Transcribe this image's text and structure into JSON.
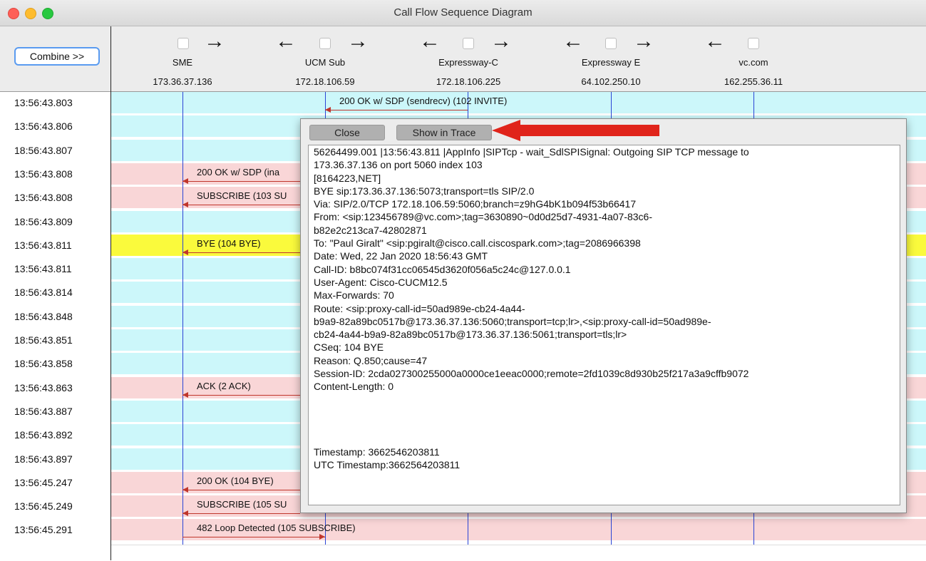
{
  "window": {
    "title": "Call Flow Sequence Diagram"
  },
  "toolbar": {
    "combine_label": "Combine >>"
  },
  "endpoints": [
    {
      "name": "SME",
      "ip": "173.36.37.136"
    },
    {
      "name": "UCM Sub",
      "ip": "172.18.106.59"
    },
    {
      "name": "Expressway-C",
      "ip": "172.18.106.225"
    },
    {
      "name": "Expressway E",
      "ip": "64.102.250.10"
    },
    {
      "name": "vc.com",
      "ip": "162.255.36.11"
    }
  ],
  "arrows": {
    "right": "→",
    "left": "←"
  },
  "rows": [
    {
      "time": "13:56:43.803",
      "color": "cyan",
      "label": "200 OK w/ SDP (sendrecv)  (102 INVITE)"
    },
    {
      "time": "13:56:43.806",
      "color": "cyan",
      "label": ""
    },
    {
      "time": "18:56:43.807",
      "color": "cyan",
      "label": ""
    },
    {
      "time": "13:56:43.808",
      "color": "pink",
      "label": "200 OK w/ SDP (ina"
    },
    {
      "time": "13:56:43.808",
      "color": "pink",
      "label": "SUBSCRIBE (103 SU"
    },
    {
      "time": "18:56:43.809",
      "color": "cyan",
      "label": ""
    },
    {
      "time": "13:56:43.811",
      "color": "yellow",
      "label": "BYE (104 BYE)"
    },
    {
      "time": "13:56:43.811",
      "color": "cyan",
      "label": ""
    },
    {
      "time": "18:56:43.814",
      "color": "cyan",
      "label": ""
    },
    {
      "time": "18:56:43.848",
      "color": "cyan",
      "label": ""
    },
    {
      "time": "18:56:43.851",
      "color": "cyan",
      "label": ""
    },
    {
      "time": "18:56:43.858",
      "color": "cyan",
      "label": ""
    },
    {
      "time": "13:56:43.863",
      "color": "pink",
      "label": "ACK (2 ACK)"
    },
    {
      "time": "18:56:43.887",
      "color": "cyan",
      "label": ""
    },
    {
      "time": "18:56:43.892",
      "color": "cyan",
      "label": ""
    },
    {
      "time": "18:56:43.897",
      "color": "cyan",
      "label": ""
    },
    {
      "time": "13:56:45.247",
      "color": "pink",
      "label": "200 OK (104 BYE)"
    },
    {
      "time": "13:56:45.249",
      "color": "pink",
      "label": "SUBSCRIBE (105 SU"
    },
    {
      "time": "13:56:45.291",
      "color": "pink",
      "label": "482 Loop Detected (105 SUBSCRIBE)"
    }
  ],
  "popup": {
    "close_label": "Close",
    "show_trace_label": "Show in Trace",
    "lines": [
      "56264499.001 |13:56:43.811 |AppInfo  |SIPTcp - wait_SdlSPISignal: Outgoing SIP TCP message to",
      "173.36.37.136 on port 5060 index 103",
      "[8164223,NET]",
      "BYE sip:173.36.37.136:5073;transport=tls SIP/2.0",
      "Via: SIP/2.0/TCP 172.18.106.59:5060;branch=z9hG4bK1b094f53b66417",
      "From: <sip:123456789@vc.com>;tag=3630890~0d0d25d7-4931-4a07-83c6-",
      "b82e2c213ca7-42802871",
      "To: \"Paul Giralt\" <sip:pgiralt@cisco.call.ciscospark.com>;tag=2086966398",
      "Date: Wed, 22 Jan 2020 18:56:43 GMT",
      "Call-ID: b8bc074f31cc06545d3620f056a5c24c@127.0.0.1",
      "User-Agent: Cisco-CUCM12.5",
      "Max-Forwards: 70",
      "Route: <sip:proxy-call-id=50ad989e-cb24-4a44-",
      "b9a9-82a89bc0517b@173.36.37.136:5060;transport=tcp;lr>,<sip:proxy-call-id=50ad989e-",
      "cb24-4a44-b9a9-82a89bc0517b@173.36.37.136:5061;transport=tls;lr>",
      "CSeq: 104 BYE",
      "Reason: Q.850;cause=47",
      "Session-ID: 2cda027300255000a0000ce1eeac0000;remote=2fd1039c8d930b25f217a3a9cffb9072",
      "Content-Length: 0",
      "",
      "",
      "",
      "",
      "Timestamp: 3662546203811",
      "UTC Timestamp:3662564203811"
    ]
  },
  "colors": {
    "cyan": "#ccf7fa",
    "pink": "#f9d6d7",
    "yellow": "#fafa3c",
    "lifeline": "#2b45d6",
    "message_arrow": "#c0362c",
    "annotation_arrow": "#e0241b"
  }
}
